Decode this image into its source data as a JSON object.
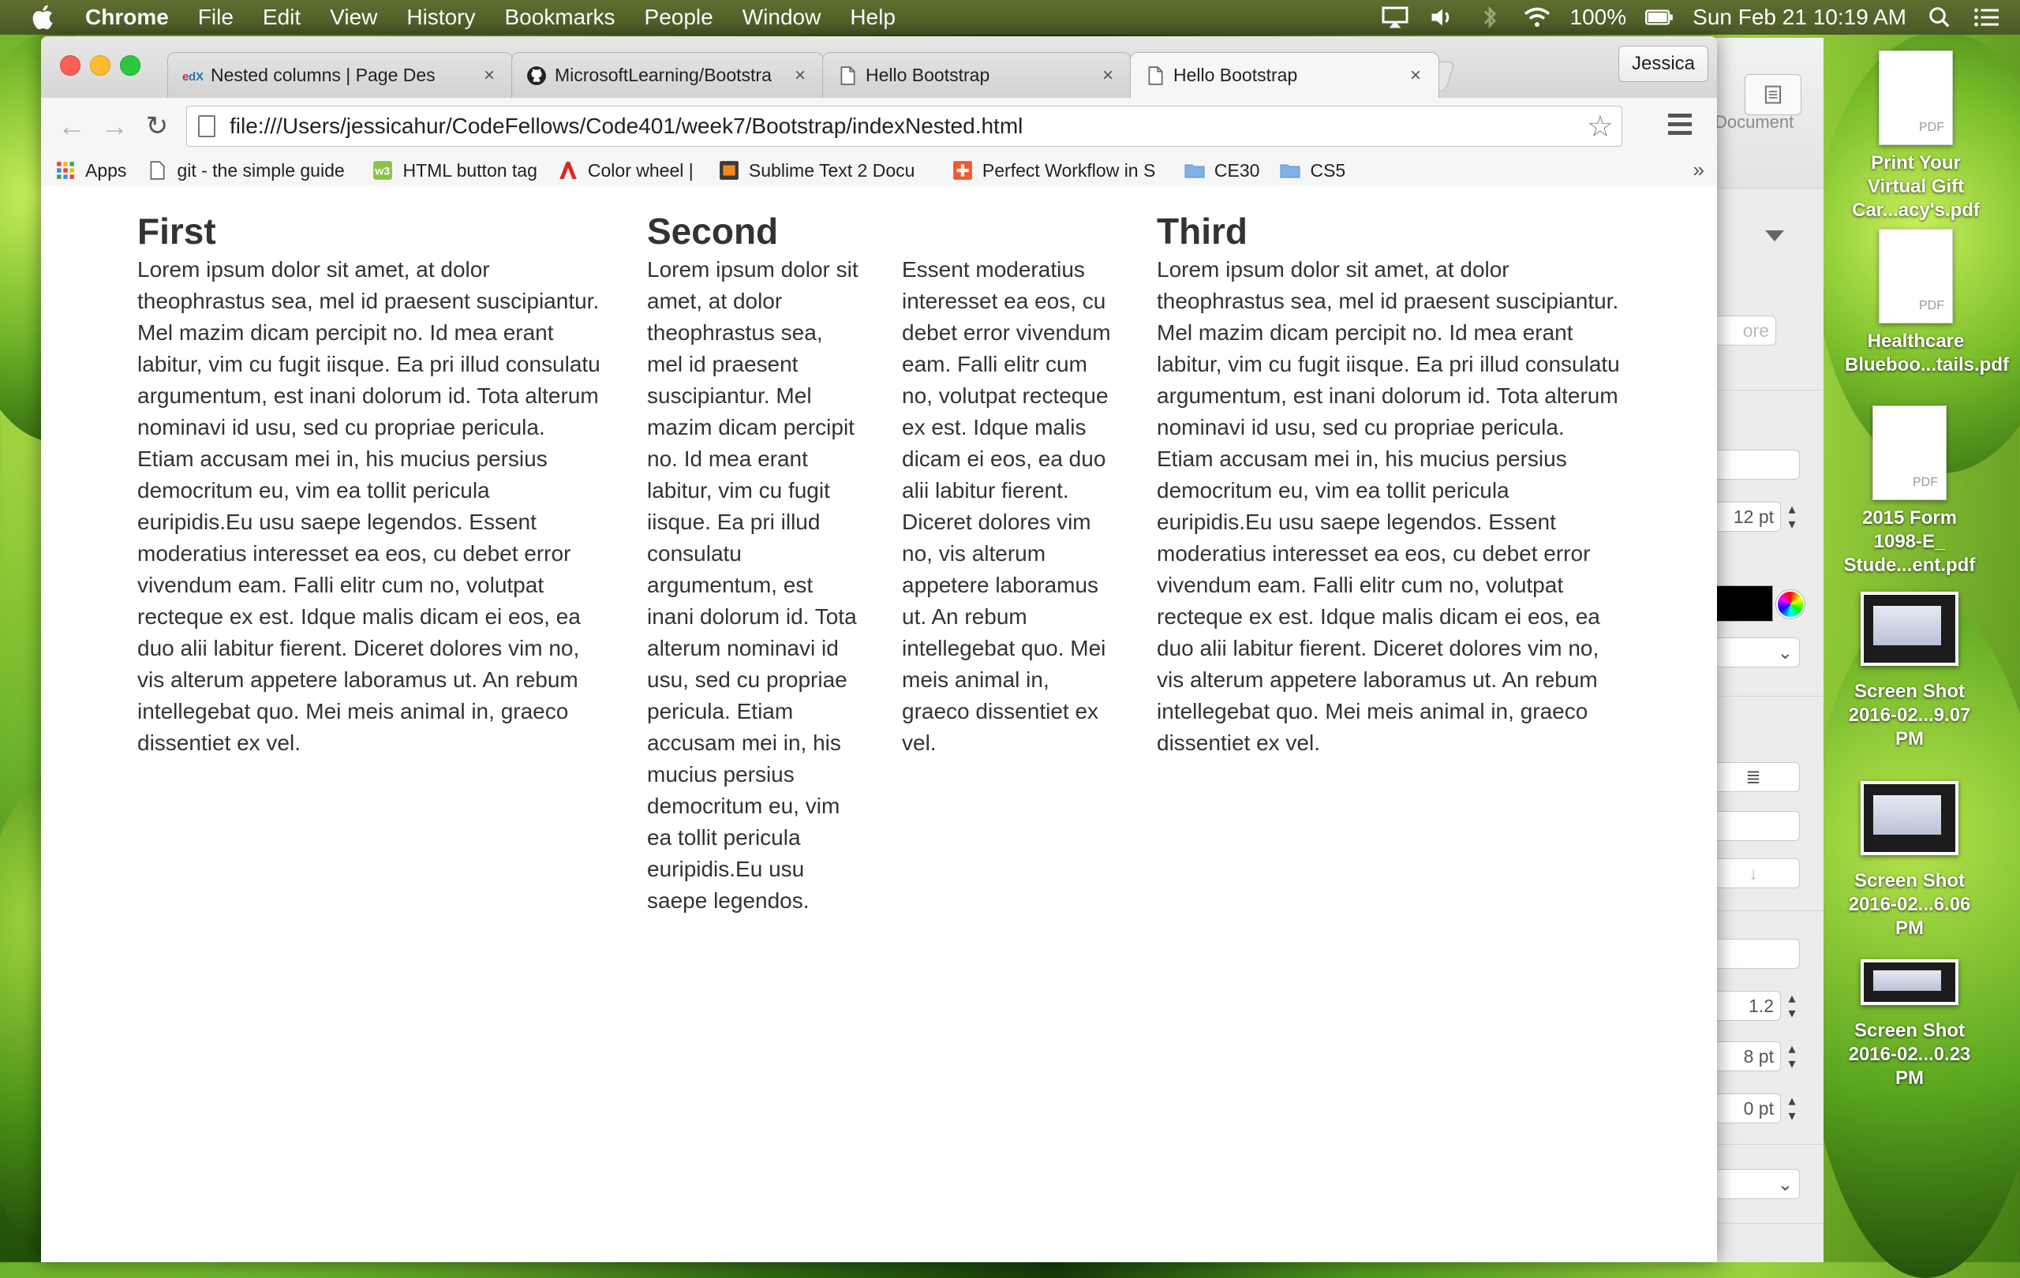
{
  "menubar": {
    "app": "Chrome",
    "items": [
      "File",
      "Edit",
      "View",
      "History",
      "Bookmarks",
      "People",
      "Window",
      "Help"
    ],
    "battery": "100%",
    "clock": "Sun Feb 21  10:19 AM"
  },
  "browser": {
    "tabs": [
      {
        "title": "Nested columns | Page Des",
        "icon": "edx-icon"
      },
      {
        "title": "MicrosoftLearning/Bootstra",
        "icon": "github-icon"
      },
      {
        "title": "Hello Bootstrap",
        "icon": "page-icon"
      },
      {
        "title": "Hello Bootstrap",
        "icon": "page-icon"
      }
    ],
    "profile": "Jessica",
    "url": "file:///Users/jessicahur/CodeFellows/Code401/week7/Bootstrap/indexNested.html",
    "bookmarks": [
      {
        "label": "Apps"
      },
      {
        "label": "git - the simple guide"
      },
      {
        "label": "HTML button tag"
      },
      {
        "label": "Color wheel | Color s"
      },
      {
        "label": "Sublime Text 2 Docu"
      },
      {
        "label": "Perfect Workflow in S"
      },
      {
        "label": "CE30"
      },
      {
        "label": "CS5"
      }
    ],
    "more": "»"
  },
  "page": {
    "first": {
      "heading": "First",
      "text": "Lorem ipsum dolor sit amet, at dolor theophrastus sea, mel id praesent suscipiantur. Mel mazim dicam percipit no. Id mea erant labitur, vim cu fugit iisque. Ea pri illud consulatu argumentum, est inani dolorum id. Tota alterum nominavi id usu, sed cu propriae pericula. Etiam accusam mei in, his mucius persius democritum eu, vim ea tollit pericula euripidis.Eu usu saepe legendos. Essent moderatius interesset ea eos, cu debet error vivendum eam. Falli elitr cum no, volutpat recteque ex est. Idque malis dicam ei eos, ea duo alii labitur fierent. Diceret dolores vim no, vis alterum appetere laboramus ut. An rebum intellegebat quo. Mei meis animal in, graeco dissentiet ex vel."
    },
    "second": {
      "heading": "Second",
      "left_text": "Lorem ipsum dolor sit amet, at dolor theophrastus sea, mel id praesent suscipiantur. Mel mazim dicam percipit no. Id mea erant labitur, vim cu fugit iisque. Ea pri illud consulatu argumentum, est inani dolorum id. Tota alterum nominavi id usu, sed cu propriae pericula. Etiam accusam mei in, his mucius persius democritum eu, vim ea tollit pericula euripidis.Eu usu saepe legendos.",
      "right_text": "Essent moderatius interesset ea eos, cu debet error vivendum eam. Falli elitr cum no, volutpat recteque ex est. Idque malis dicam ei eos, ea duo alii labitur fierent. Diceret dolores vim no, vis alterum appetere laboramus ut. An rebum intellegebat quo. Mei meis animal in, graeco dissentiet ex vel."
    },
    "third": {
      "heading": "Third",
      "text": "Lorem ipsum dolor sit amet, at dolor theophrastus sea, mel id praesent suscipiantur. Mel mazim dicam percipit no. Id mea erant labitur, vim cu fugit iisque. Ea pri illud consulatu argumentum, est inani dolorum id. Tota alterum nominavi id usu, sed cu propriae pericula. Etiam accusam mei in, his mucius persius democritum eu, vim ea tollit pericula euripidis.Eu usu saepe legendos. Essent moderatius interesset ea eos, cu debet error vivendum eam. Falli elitr cum no, volutpat recteque ex est. Idque malis dicam ei eos, ea duo alii labitur fierent. Diceret dolores vim no, vis alterum appetere laboramus ut. An rebum intellegebat quo. Mei meis animal in, graeco dissentiet ex vel."
    }
  },
  "inspector": {
    "document_label": "Document",
    "size": "12 pt",
    "line_spacing": "1.2",
    "before": "8 pt",
    "after": "0 pt",
    "more_label": "ore"
  },
  "desktop": [
    {
      "name": "Print Your Virtual Gift Car...acy's.pdf",
      "kind": "pdf"
    },
    {
      "name": "Healthcare Blueboo...tails.pdf",
      "kind": "pdf"
    },
    {
      "name": "2015 Form 1098-E_ Stude...ent.pdf",
      "kind": "pdf"
    },
    {
      "name": "Screen Shot 2016-02...9.07 PM",
      "kind": "screenshot"
    },
    {
      "name": "Screen Shot 2016-02...6.06 PM",
      "kind": "screenshot"
    },
    {
      "name": "Screen Shot 2016-02...0.23 PM",
      "kind": "screenshot"
    }
  ],
  "pdf_tag": "PDF"
}
